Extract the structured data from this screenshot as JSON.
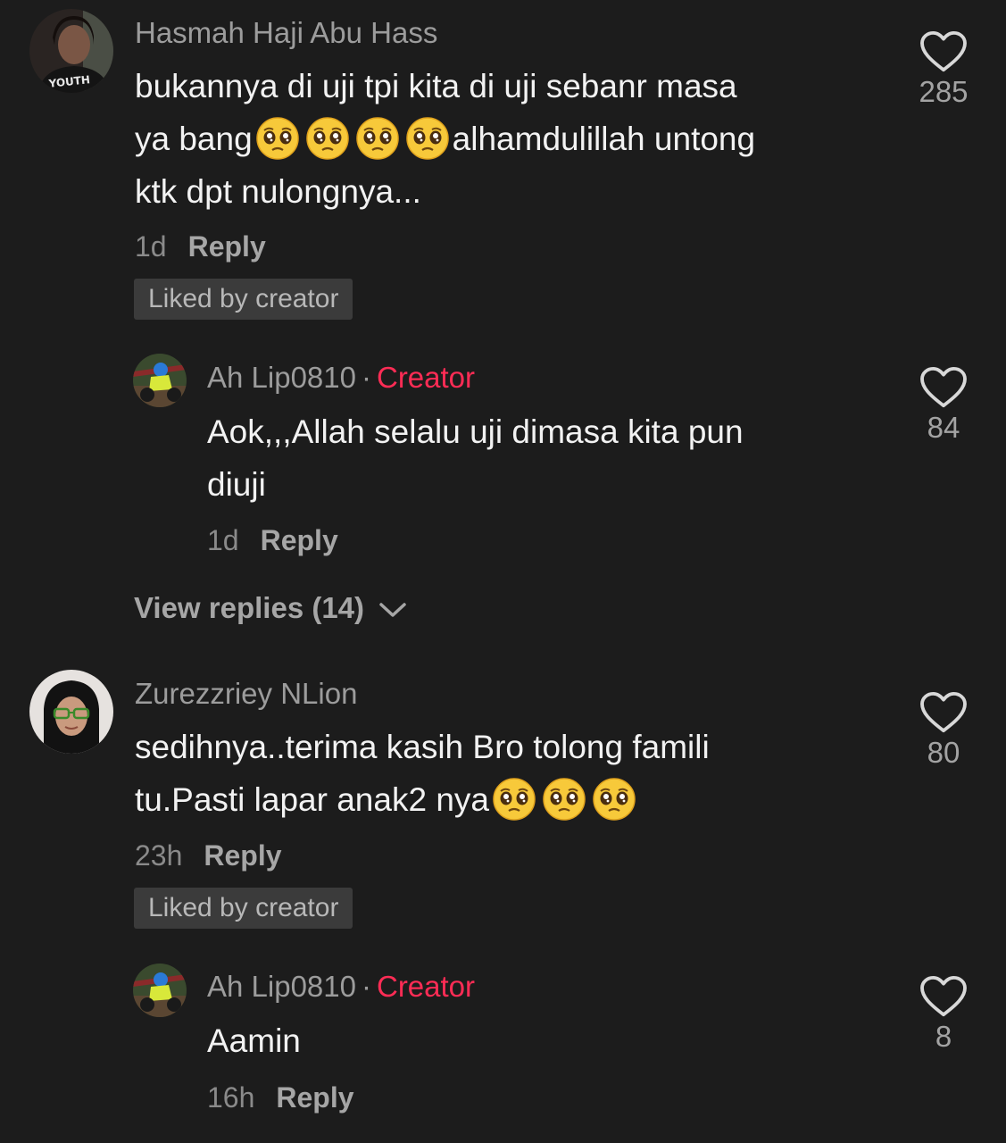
{
  "comments": [
    {
      "username": "Hasmah Haji Abu Hass",
      "text_line1": "bukannya di uji tpi kita di uji sebanr masa",
      "text_line2_start": "ya bang",
      "text_line2_end": "alhamdulillah untong",
      "text_line3": "ktk dpt nulongnya...",
      "emojis": [
        "pleading-face",
        "pleading-face",
        "pleading-face",
        "pleading-face"
      ],
      "time": "1d",
      "reply_label": "Reply",
      "liked_label": "Liked by creator",
      "likes": "285",
      "reply": {
        "username": "Ah Lip0810",
        "dot": "·",
        "badge": "Creator",
        "text_line1": "Aok,,,Allah selalu uji dimasa kita pun",
        "text_line2": "diuji",
        "time": "1d",
        "reply_label": "Reply",
        "likes": "84"
      },
      "view_replies": "View replies (14)"
    },
    {
      "username": "Zurezzriey NLion",
      "text_line1": "sedihnya..terima kasih Bro tolong famili",
      "text_line2": "tu.Pasti lapar anak2 nya",
      "emojis": [
        "pleading-face",
        "pleading-face",
        "pleading-face"
      ],
      "time": "23h",
      "reply_label": "Reply",
      "liked_label": "Liked by creator",
      "likes": "80",
      "reply": {
        "username": "Ah Lip0810",
        "dot": "·",
        "badge": "Creator",
        "text": "Aamin",
        "time": "16h",
        "reply_label": "Reply",
        "likes": "8"
      }
    }
  ],
  "icons": {
    "like": "heart-outline-icon",
    "expand": "chevron-down-icon",
    "emoji": "pleading-face-emoji"
  },
  "colors": {
    "background": "#1c1c1c",
    "creator_badge": "#fe2c55",
    "secondary_text": "#9c9c9c"
  }
}
